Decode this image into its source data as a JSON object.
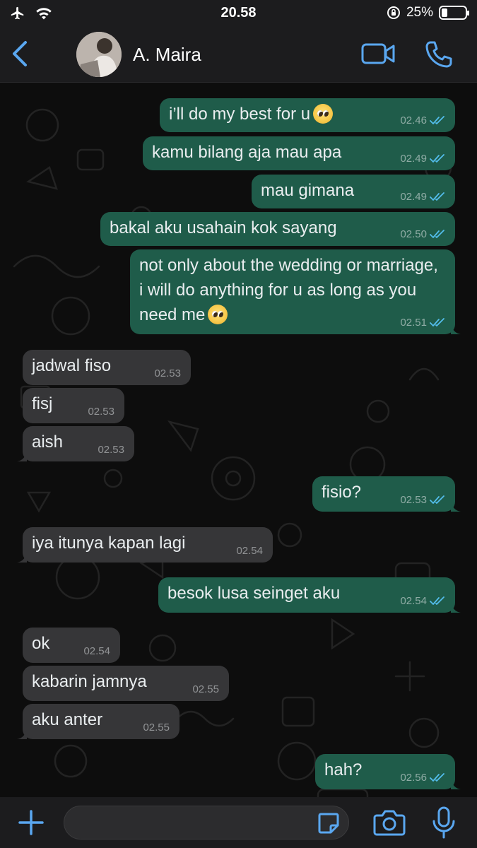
{
  "status_bar": {
    "time": "20.58",
    "battery": "25%"
  },
  "header": {
    "contact_name": "A. Maira"
  },
  "messages": [
    {
      "dir": "out",
      "text": "i’ll do my best for u",
      "emoji": "pleading-face",
      "time": "02.46"
    },
    {
      "dir": "out",
      "text": "kamu bilang aja mau apa",
      "time": "02.49"
    },
    {
      "dir": "out",
      "text": "mau gimana",
      "time": "02.49"
    },
    {
      "dir": "out",
      "text": "bakal aku usahain kok sayang",
      "time": "02.50"
    },
    {
      "dir": "out",
      "text": "not only about the wedding or marriage, i will do anything for u as long as you need me",
      "emoji": "pleading-face",
      "time": "02.51"
    },
    {
      "dir": "in",
      "text": "jadwal fiso",
      "time": "02.53"
    },
    {
      "dir": "in",
      "text": "fisj",
      "time": "02.53"
    },
    {
      "dir": "in",
      "text": "aish",
      "time": "02.53"
    },
    {
      "dir": "out",
      "text": "fisio?",
      "time": "02.53"
    },
    {
      "dir": "in",
      "text": "iya itunya kapan lagi",
      "time": "02.54"
    },
    {
      "dir": "out",
      "text": "besok lusa seinget aku",
      "time": "02.54"
    },
    {
      "dir": "in",
      "text": "ok",
      "time": "02.54"
    },
    {
      "dir": "in",
      "text": "kabarin jamnya",
      "time": "02.55"
    },
    {
      "dir": "in",
      "text": "aku anter",
      "time": "02.55"
    },
    {
      "dir": "out",
      "text": "hah?",
      "time": "02.56"
    }
  ],
  "input": {
    "value": "",
    "placeholder": ""
  },
  "colors": {
    "accent": "#5aa7f0",
    "outgoing_bubble": "#1f5c4a",
    "incoming_bubble": "#363638",
    "read_ticks": "#53bdeb"
  },
  "icons": {
    "status_left": [
      "airplane-icon",
      "wifi-icon"
    ],
    "status_right": [
      "rotation-lock-icon",
      "battery-icon"
    ],
    "header": [
      "back-chevron-icon",
      "video-camera-icon",
      "phone-icon"
    ],
    "input_bar": [
      "plus-icon",
      "sticker-icon",
      "camera-icon",
      "microphone-icon"
    ]
  }
}
